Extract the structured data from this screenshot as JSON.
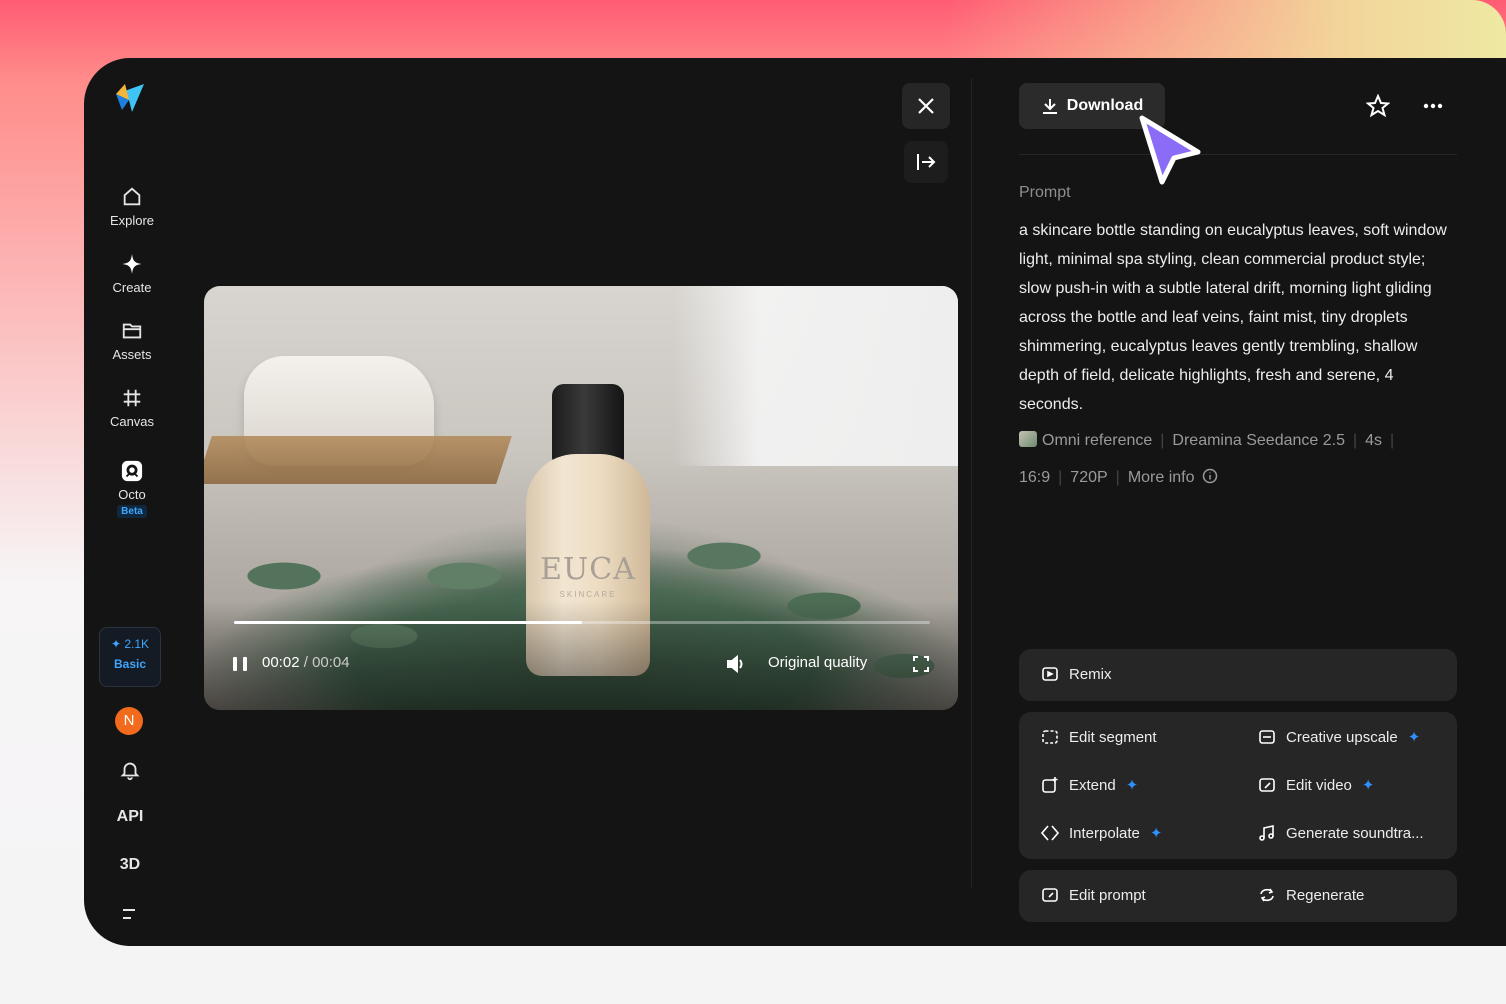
{
  "sidebar": {
    "nav": [
      {
        "label": "Explore",
        "icon": "home-icon"
      },
      {
        "label": "Create",
        "icon": "sparkle-icon"
      },
      {
        "label": "Assets",
        "icon": "folder-icon"
      },
      {
        "label": "Canvas",
        "icon": "canvas-icon"
      },
      {
        "label": "Octo",
        "icon": "octo-icon",
        "badge": "Beta"
      }
    ],
    "credits": {
      "amount": "2.1K",
      "plan": "Basic"
    },
    "avatar_initial": "N",
    "api_label": "API",
    "three_d_label": "3D"
  },
  "video": {
    "current_time": "00:02",
    "duration": "00:04",
    "progress_fraction": 0.5,
    "quality_label": "Original quality",
    "bottle_brand": "EUCA",
    "bottle_sub": "SKINCARE"
  },
  "panel": {
    "download_label": "Download",
    "prompt_title": "Prompt",
    "prompt_text": "a skincare bottle standing on eucalyptus leaves, soft window light, minimal spa styling, clean commercial product style; slow push-in with a subtle lateral drift, morning light gliding across the bottle and leaf veins, faint mist, tiny droplets shimmering, eucalyptus leaves gently trembling, shallow depth of field, delicate highlights, fresh and serene, 4 seconds.",
    "meta_row1": [
      "Omni reference",
      "Dreamina Seedance 2.5",
      "4s"
    ],
    "meta_row2": [
      "16:9",
      "720P",
      "More info"
    ],
    "remix_label": "Remix",
    "actions": [
      {
        "label": "Edit segment",
        "icon": "edit-segment-icon",
        "spark": false
      },
      {
        "label": "Creative upscale",
        "icon": "hd-icon",
        "spark": true
      },
      {
        "label": "Extend",
        "icon": "extend-icon",
        "spark": true
      },
      {
        "label": "Edit video",
        "icon": "edit-video-icon",
        "spark": true
      },
      {
        "label": "Interpolate",
        "icon": "interpolate-icon",
        "spark": true
      },
      {
        "label": "Generate soundtra...",
        "icon": "music-icon",
        "spark": false
      }
    ],
    "edit_prompt_label": "Edit prompt",
    "regenerate_label": "Regenerate"
  },
  "colors": {
    "accent": "#2f8fff",
    "cursor": "#8b6cf6",
    "avatar": "#f26a1b"
  }
}
